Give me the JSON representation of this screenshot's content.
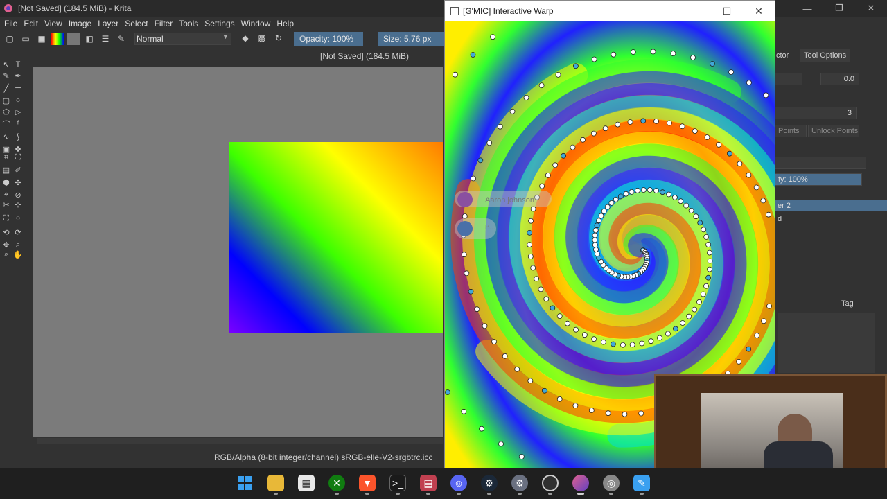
{
  "krita": {
    "title": "[Not Saved]  (184.5 MiB)  - Krita",
    "menu": [
      "File",
      "Edit",
      "View",
      "Image",
      "Layer",
      "Select",
      "Filter",
      "Tools",
      "Settings",
      "Window",
      "Help"
    ],
    "toolbar": {
      "blend_mode": "Normal",
      "opacity": "Opacity: 100%",
      "size": "Size: 5.76 px"
    },
    "doc_title": "[Not Saved]  (184.5 MiB)",
    "status": "RGB/Alpha (8-bit integer/channel)  sRGB-elle-V2-srgbtrc.icc",
    "dock": {
      "tab_partial": "ctor",
      "tab_tool_options": "Tool Options",
      "value_1": "0.0",
      "value_2": "3",
      "points_btn": "Points",
      "unlock_btn": "Unlock Points",
      "layer_opacity": "ty:  100%",
      "layer_2": "er 2",
      "layer_3": "d",
      "tag_label": "Tag"
    }
  },
  "gmic": {
    "title": "[G'MIC] Interactive Warp",
    "overlay_name": "Aaron johnson",
    "overlay_name_2": "B..."
  },
  "colors": {
    "accent": "#4a6e8f",
    "krita_bg": "#323232",
    "canvas": "#7b7b7b"
  },
  "taskbar": {
    "icons": [
      "windows-start-icon",
      "file-explorer-icon",
      "store-icon",
      "xbox-icon",
      "brave-icon",
      "terminal-icon",
      "app-icon",
      "discord-icon",
      "steam-icon",
      "settings-icon",
      "obs-icon",
      "krita-icon",
      "app2-icon",
      "app3-icon"
    ]
  }
}
